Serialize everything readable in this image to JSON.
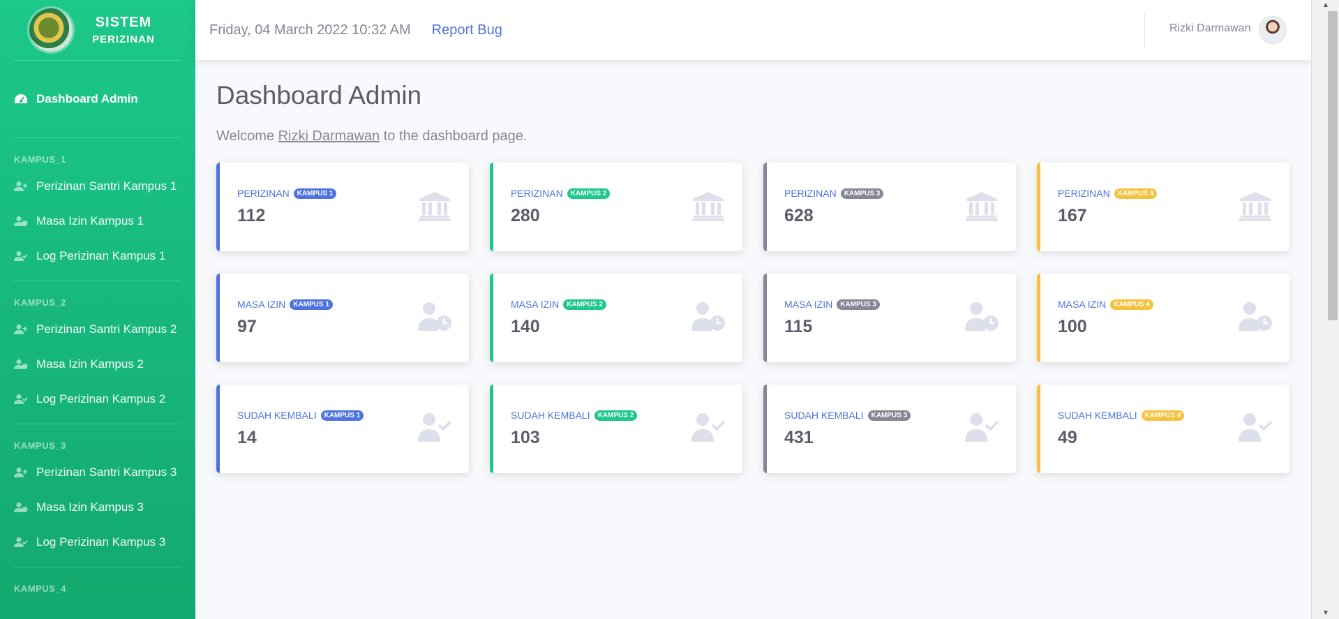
{
  "sidebar": {
    "brand_line1": "SISTEM",
    "brand_line2": "PERIZINAN",
    "dashboard_label": "Dashboard Admin",
    "sections": [
      {
        "label": "KAMPUS_1",
        "items": [
          "Perizinan Santri Kampus 1",
          "Masa Izin Kampus 1",
          "Log Perizinan Kampus 1"
        ]
      },
      {
        "label": "KAMPUS_2",
        "items": [
          "Perizinan Santri Kampus 2",
          "Masa Izin Kampus 2",
          "Log Perizinan Kampus 2"
        ]
      },
      {
        "label": "KAMPUS_3",
        "items": [
          "Perizinan Santri Kampus 3",
          "Masa Izin Kampus 3",
          "Log Perizinan Kampus 3"
        ]
      },
      {
        "label": "KAMPUS_4"
      }
    ]
  },
  "topbar": {
    "datetime": "Friday, 04 March 2022 10:32 AM",
    "report_bug": "Report Bug",
    "user_name": "Rizki Darmawan"
  },
  "main": {
    "title": "Dashboard Admin",
    "welcome_pre": "Welcome",
    "welcome_user": "Rizki Darmawan",
    "welcome_post": "to the dashboard page.",
    "rows": [
      {
        "label": "PERIZINAN",
        "icon": "building-icon",
        "cards": [
          {
            "badge": "KAMPUS 1",
            "value": "112"
          },
          {
            "badge": "KAMPUS 2",
            "value": "280"
          },
          {
            "badge": "KAMPUS 3",
            "value": "628"
          },
          {
            "badge": "KAMPUS 4",
            "value": "167"
          }
        ]
      },
      {
        "label": "MASA IZIN",
        "icon": "user-clock-icon",
        "cards": [
          {
            "badge": "KAMPUS 1",
            "value": "97"
          },
          {
            "badge": "KAMPUS 2",
            "value": "140"
          },
          {
            "badge": "KAMPUS 3",
            "value": "115"
          },
          {
            "badge": "KAMPUS 4",
            "value": "100"
          }
        ]
      },
      {
        "label": "SUDAH KEMBALI",
        "icon": "user-check-icon",
        "cards": [
          {
            "badge": "KAMPUS 1",
            "value": "14"
          },
          {
            "badge": "KAMPUS 2",
            "value": "103"
          },
          {
            "badge": "KAMPUS 3",
            "value": "431"
          },
          {
            "badge": "KAMPUS 4",
            "value": "49"
          }
        ]
      }
    ]
  },
  "colors": {
    "sidebar": "#1cc88a",
    "kampus1": "#4e73df",
    "kampus2": "#1cc88a",
    "kampus3": "#858796",
    "kampus4": "#f6c23e"
  }
}
